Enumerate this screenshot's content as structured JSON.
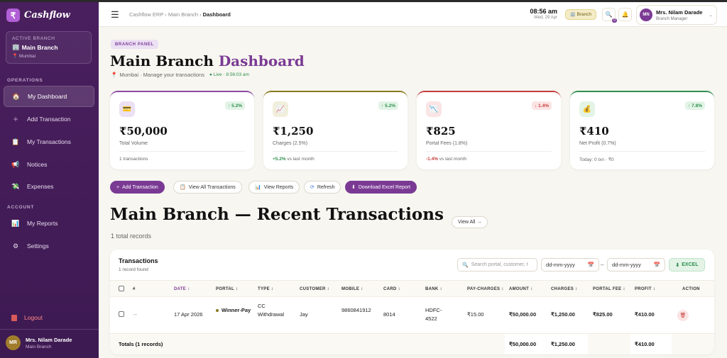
{
  "sidebar": {
    "brand": "Cashflow",
    "active_branch_label": "ACTIVE BRANCH",
    "branch_name": "Main Branch",
    "branch_location": "Mumbai",
    "sections": {
      "operations": "OPERATIONS",
      "account": "ACCOUNT"
    },
    "items": [
      {
        "label": "My Dashboard",
        "icon": "house-icon"
      },
      {
        "label": "Add Transaction",
        "icon": "plus-icon"
      },
      {
        "label": "My Transactions",
        "icon": "clipboard-icon"
      },
      {
        "label": "Notices",
        "icon": "megaphone-icon"
      },
      {
        "label": "Expenses",
        "icon": "money-icon"
      },
      {
        "label": "My Reports",
        "icon": "bar-chart-icon"
      },
      {
        "label": "Settings",
        "icon": "gear-icon"
      }
    ],
    "logout": "Logout",
    "user": {
      "initials": "MR",
      "name": "Mrs. Nilam Darade",
      "branch": "Main Branch"
    }
  },
  "header": {
    "breadcrumb": [
      "Cashflow ERP",
      "Main Branch",
      "Dashboard"
    ],
    "time": "08:56 am",
    "date": "Wed, 29 Apr",
    "branch_pill": "Branch",
    "notification_badge": "0",
    "profile": {
      "initials": "MN",
      "name": "Mrs. Nilam Darade",
      "role": "Branch Manager"
    }
  },
  "page": {
    "panel_label": "BRANCH PANEL",
    "title_main": "Main Branch",
    "title_accent": "Dashboard",
    "subtitle": "Mumbai · Manage your transactions",
    "live": "Live · 8:56:03 am"
  },
  "stats": [
    {
      "value": "₹50,000",
      "label": "Total Volume",
      "badge": "↑ 5.2%",
      "trend": "up",
      "foot_strong": "",
      "foot": "1 transactions",
      "icon": "card-icon",
      "color": "#8b4aa6"
    },
    {
      "value": "₹1,250",
      "label": "Charges (2.5%)",
      "badge": "↑ 5.2%",
      "trend": "up",
      "foot_strong": "+5.2%",
      "foot": " vs last month",
      "icon": "trend-chart-icon",
      "color": "#8a7a1f"
    },
    {
      "value": "₹825",
      "label": "Portal Fees (1.8%)",
      "badge": "↓ 1.4%",
      "trend": "down",
      "foot_strong": "-1.4%",
      "foot": " vs last month",
      "icon": "down-chart-icon",
      "color": "#c73b3b"
    },
    {
      "value": "₹410",
      "label": "Net Profit (0.7%)",
      "badge": "↑ 7.8%",
      "trend": "up",
      "foot_strong": "",
      "foot": "Today: 0 txn · ₹0",
      "icon": "money-bag-icon",
      "color": "#2f8f4e"
    }
  ],
  "actions": [
    "Add Transaction",
    "View All Transactions",
    "View Reports",
    "Refresh",
    "Download Excel Report"
  ],
  "recent": {
    "title": "Main Branch — Recent Transactions",
    "records": "1 total records",
    "view_all": "View All →"
  },
  "table": {
    "title": "Transactions",
    "subtitle": "1 record found",
    "search_placeholder": "Search portal, customer, t",
    "date_from": "dd-mm-yyyy",
    "date_to": "dd-mm-yyyy",
    "excel": "EXCEL",
    "columns": [
      "#",
      "DATE",
      "PORTAL",
      "TYPE",
      "CUSTOMER",
      "MOBILE",
      "CARD",
      "BANK",
      "PAY-CHARGES",
      "AMOUNT",
      "CHARGES",
      "PORTAL FEE",
      "PROFIT",
      "ACTION"
    ],
    "rows": [
      {
        "num": "↔",
        "date": "17 Apr 2026",
        "portal": "Winner-Pay",
        "type": "CC Withdrawal",
        "customer": "Jay",
        "mobile": "9860841912",
        "card": "8014",
        "bank": "HDFC-4522",
        "pay_charges": "₹15.00",
        "amount": "₹50,000.00",
        "charges": "₹1,250.00",
        "portal_fee": "₹825.00",
        "profit": "₹410.00"
      }
    ],
    "totals": {
      "label": "Totals (1 records)",
      "amount": "₹50,000.00",
      "charges": "₹1,250.00",
      "profit": "₹410.00"
    }
  },
  "colors": {
    "brand": "#7a3a94",
    "sidebar": "#4a1f5e",
    "up": "#2f8f4e",
    "down": "#c73b3b"
  }
}
